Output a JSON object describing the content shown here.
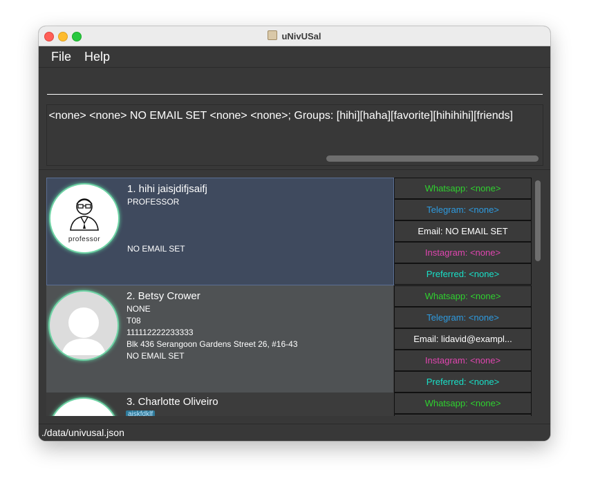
{
  "window": {
    "title": "uNivUSal"
  },
  "menu": {
    "file": "File",
    "help": "Help"
  },
  "command": {
    "value": ""
  },
  "result": {
    "text": "l: <none> <none> NO EMAIL SET <none> <none>; Groups: [hihi][haha][favorite][hihihihi][friends]"
  },
  "persons": [
    {
      "index_name": "1.  hihi jaisjdifjsaifj",
      "occupation": "PROFESSOR",
      "email": "NO EMAIL SET",
      "avatar_caption": "professor",
      "socials": {
        "whatsapp": "Whatsapp: <none>",
        "telegram": "Telegram: <none>",
        "email": "Email: NO EMAIL SET",
        "instagram": "Instagram: <none>",
        "preferred": "Preferred: <none>"
      }
    },
    {
      "index_name": "2.  Betsy Crower",
      "occupation": "NONE",
      "tutorial": "T08",
      "phone": "111112222233333",
      "address": "Blk 436 Serangoon Gardens Street 26, #16-43",
      "email": "NO EMAIL SET",
      "socials": {
        "whatsapp": "Whatsapp: <none>",
        "telegram": "Telegram: <none>",
        "email": "Email: lidavid@exampl...",
        "instagram": "Instagram: <none>",
        "preferred": "Preferred: <none>"
      }
    },
    {
      "index_name": "3.  Charlotte Oliveiro",
      "tag": "ajskfdklf",
      "socials": {
        "whatsapp": "Whatsapp: <none>"
      }
    }
  ],
  "status": {
    "path": "./data/univusal.json"
  },
  "colors": {
    "whatsapp": "#2fd12f",
    "telegram": "#2e9be0",
    "email": "#ffffff",
    "instagram": "#e046b0",
    "preferred": "#19e0c8",
    "avatar_glow": "#6fd3a5"
  }
}
